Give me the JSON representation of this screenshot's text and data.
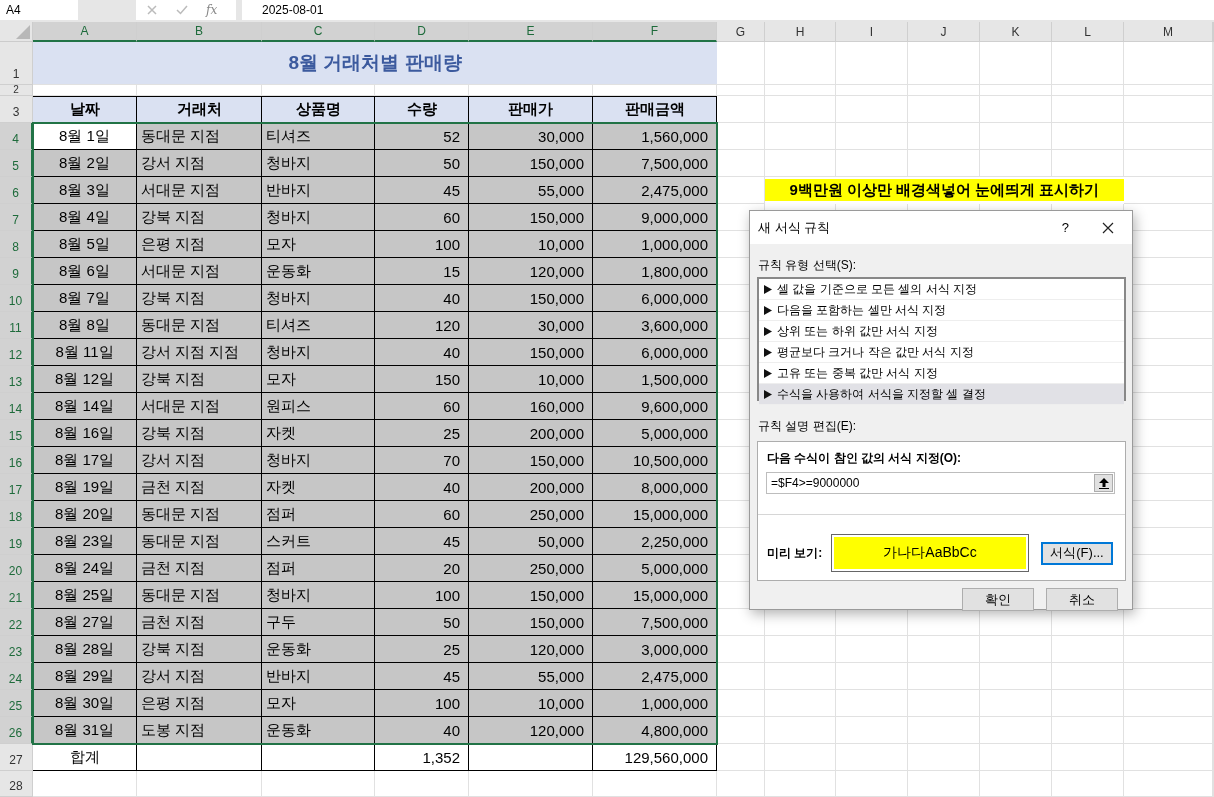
{
  "formula_bar": {
    "name_box": "A4",
    "function_label": "fx",
    "value": "2025-08-01"
  },
  "columns": [
    {
      "label": "A",
      "selected": true
    },
    {
      "label": "B",
      "selected": true
    },
    {
      "label": "C",
      "selected": true
    },
    {
      "label": "D",
      "selected": true
    },
    {
      "label": "E",
      "selected": true
    },
    {
      "label": "F",
      "selected": true
    },
    {
      "label": "G",
      "selected": false
    },
    {
      "label": "H",
      "selected": false
    },
    {
      "label": "I",
      "selected": false
    },
    {
      "label": "J",
      "selected": false
    },
    {
      "label": "K",
      "selected": false
    },
    {
      "label": "L",
      "selected": false
    },
    {
      "label": "M",
      "selected": false
    }
  ],
  "row_numbers": [
    {
      "label": "1",
      "selected": false
    },
    {
      "label": "2",
      "selected": false
    },
    {
      "label": "3",
      "selected": false
    },
    {
      "label": "4",
      "selected": true
    },
    {
      "label": "5",
      "selected": true
    },
    {
      "label": "6",
      "selected": true
    },
    {
      "label": "7",
      "selected": true
    },
    {
      "label": "8",
      "selected": true
    },
    {
      "label": "9",
      "selected": true
    },
    {
      "label": "10",
      "selected": true
    },
    {
      "label": "11",
      "selected": true
    },
    {
      "label": "12",
      "selected": true
    },
    {
      "label": "13",
      "selected": true
    },
    {
      "label": "14",
      "selected": true
    },
    {
      "label": "15",
      "selected": true
    },
    {
      "label": "16",
      "selected": true
    },
    {
      "label": "17",
      "selected": true
    },
    {
      "label": "18",
      "selected": true
    },
    {
      "label": "19",
      "selected": true
    },
    {
      "label": "20",
      "selected": true
    },
    {
      "label": "21",
      "selected": true
    },
    {
      "label": "22",
      "selected": true
    },
    {
      "label": "23",
      "selected": true
    },
    {
      "label": "24",
      "selected": true
    },
    {
      "label": "25",
      "selected": true
    },
    {
      "label": "26",
      "selected": true
    },
    {
      "label": "27",
      "selected": false
    },
    {
      "label": "28",
      "selected": false
    }
  ],
  "title": "8월 거래처별 판매량",
  "headers": [
    "날짜",
    "거래처",
    "상품명",
    "수량",
    "판매가",
    "판매금액"
  ],
  "rows": [
    {
      "cells": [
        "8월 1일",
        "동대문 지점",
        "티셔즈",
        "52",
        "30,000",
        "1,560,000"
      ],
      "selected": true,
      "active": true
    },
    {
      "cells": [
        "8월 2일",
        "강서 지점",
        "청바지",
        "50",
        "150,000",
        "7,500,000"
      ],
      "selected": true,
      "active": false
    },
    {
      "cells": [
        "8월 3일",
        "서대문 지점",
        "반바지",
        "45",
        "55,000",
        "2,475,000"
      ],
      "selected": true,
      "active": false
    },
    {
      "cells": [
        "8월 4일",
        "강북 지점",
        "청바지",
        "60",
        "150,000",
        "9,000,000"
      ],
      "selected": true,
      "active": false
    },
    {
      "cells": [
        "8월 5일",
        "은평 지점",
        "모자",
        "100",
        "10,000",
        "1,000,000"
      ],
      "selected": true,
      "active": false
    },
    {
      "cells": [
        "8월 6일",
        "서대문 지점",
        "운동화",
        "15",
        "120,000",
        "1,800,000"
      ],
      "selected": true,
      "active": false
    },
    {
      "cells": [
        "8월 7일",
        "강북 지점",
        "청바지",
        "40",
        "150,000",
        "6,000,000"
      ],
      "selected": true,
      "active": false
    },
    {
      "cells": [
        "8월 8일",
        "동대문 지점",
        "티셔즈",
        "120",
        "30,000",
        "3,600,000"
      ],
      "selected": true,
      "active": false
    },
    {
      "cells": [
        "8월 11일",
        "강서 지점 지점",
        "청바지",
        "40",
        "150,000",
        "6,000,000"
      ],
      "selected": true,
      "active": false
    },
    {
      "cells": [
        "8월 12일",
        "강북 지점",
        "모자",
        "150",
        "10,000",
        "1,500,000"
      ],
      "selected": true,
      "active": false
    },
    {
      "cells": [
        "8월 14일",
        "서대문 지점",
        "원피스",
        "60",
        "160,000",
        "9,600,000"
      ],
      "selected": true,
      "active": false
    },
    {
      "cells": [
        "8월 16일",
        "강북 지점",
        "자켓",
        "25",
        "200,000",
        "5,000,000"
      ],
      "selected": true,
      "active": false
    },
    {
      "cells": [
        "8월 17일",
        "강서 지점",
        "청바지",
        "70",
        "150,000",
        "10,500,000"
      ],
      "selected": true,
      "active": false
    },
    {
      "cells": [
        "8월 19일",
        "금천 지점",
        "자켓",
        "40",
        "200,000",
        "8,000,000"
      ],
      "selected": true,
      "active": false
    },
    {
      "cells": [
        "8월 20일",
        "동대문 지점",
        "점퍼",
        "60",
        "250,000",
        "15,000,000"
      ],
      "selected": true,
      "active": false
    },
    {
      "cells": [
        "8월 23일",
        "동대문 지점",
        "스커트",
        "45",
        "50,000",
        "2,250,000"
      ],
      "selected": true,
      "active": false
    },
    {
      "cells": [
        "8월 24일",
        "금천 지점",
        "점퍼",
        "20",
        "250,000",
        "5,000,000"
      ],
      "selected": true,
      "active": false
    },
    {
      "cells": [
        "8월 25일",
        "동대문 지점",
        "청바지",
        "100",
        "150,000",
        "15,000,000"
      ],
      "selected": true,
      "active": false
    },
    {
      "cells": [
        "8월 27일",
        "금천 지점",
        "구두",
        "50",
        "150,000",
        "7,500,000"
      ],
      "selected": true,
      "active": false
    },
    {
      "cells": [
        "8월 28일",
        "강북 지점",
        "운동화",
        "25",
        "120,000",
        "3,000,000"
      ],
      "selected": true,
      "active": false
    },
    {
      "cells": [
        "8월 29일",
        "강서 지점",
        "반바지",
        "45",
        "55,000",
        "2,475,000"
      ],
      "selected": true,
      "active": false
    },
    {
      "cells": [
        "8월 30일",
        "은평 지점",
        "모자",
        "100",
        "10,000",
        "1,000,000"
      ],
      "selected": true,
      "active": false
    },
    {
      "cells": [
        "8월 31일",
        "도봉 지점",
        "운동화",
        "40",
        "120,000",
        "4,800,000"
      ],
      "selected": true,
      "active": false
    }
  ],
  "total": {
    "label": "합계",
    "quantity": "1,352",
    "amount": "129,560,000"
  },
  "note": "9백만원 이상만 배경색넣어 눈에띄게 표시하기",
  "dialog": {
    "title": "새 서식 규칙",
    "help": "?",
    "rule_type_label": "규칙 유형 선택(S):",
    "rule_types": [
      {
        "label": "셀 값을 기준으로 모든 셀의 서식 지정",
        "selected": false
      },
      {
        "label": "다음을 포함하는 셀만 서식 지정",
        "selected": false
      },
      {
        "label": "상위 또는 하위 값만 서식 지정",
        "selected": false
      },
      {
        "label": "평균보다 크거나 작은 값만 서식 지정",
        "selected": false
      },
      {
        "label": "고유 또는 중복 값만 서식 지정",
        "selected": false
      },
      {
        "label": "수식을 사용하여 서식을 지정할 셀 결정",
        "selected": true
      }
    ],
    "edit_label": "규칙 설명 편집(E):",
    "formula_label": "다음 수식이 참인 값의 서식 지정(O):",
    "formula": "=$F4>=9000000",
    "preview_label": "미리 보기:",
    "preview_text": "가나다AaBbCc",
    "format_button": "서식(F)...",
    "ok": "확인",
    "cancel": "취소"
  }
}
